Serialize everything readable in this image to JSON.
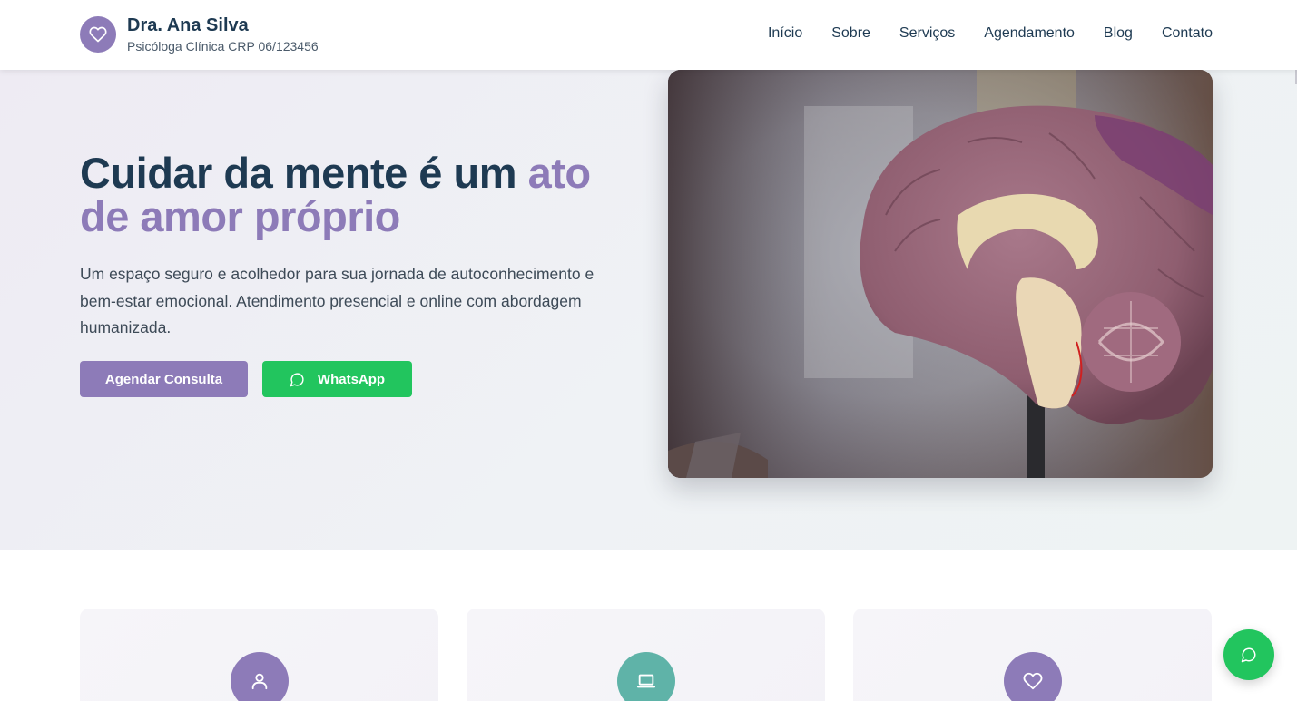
{
  "brand": {
    "name": "Dra. Ana Silva",
    "subtitle": "Psicóloga Clínica CRP 06/123456",
    "icon": "heart-icon"
  },
  "nav": {
    "items": [
      {
        "label": "Início"
      },
      {
        "label": "Sobre"
      },
      {
        "label": "Serviços"
      },
      {
        "label": "Agendamento"
      },
      {
        "label": "Blog"
      },
      {
        "label": "Contato"
      }
    ]
  },
  "hero": {
    "title_main": "Cuidar da mente é um ",
    "title_accent": "ato de amor próprio",
    "text": "Um espaço seguro e acolhedor para sua jornada de autoconhecimento e bem-estar emocional. Atendimento presencial e online com abordagem humanizada.",
    "primary_button": "Agendar Consulta",
    "whatsapp_button": "WhatsApp",
    "image_subject": "brain-model-image"
  },
  "cards": [
    {
      "icon": "user-icon",
      "color": "#8d7bb8"
    },
    {
      "icon": "laptop-icon",
      "color": "#5fb3a8"
    },
    {
      "icon": "heart-icon",
      "color": "#8d7bb8"
    }
  ],
  "colors": {
    "primary": "#8d7bb8",
    "heading": "#1e3a52",
    "whatsapp": "#22c55e",
    "teal": "#5fb3a8"
  },
  "floating": {
    "icon": "chat-bubble-icon"
  }
}
